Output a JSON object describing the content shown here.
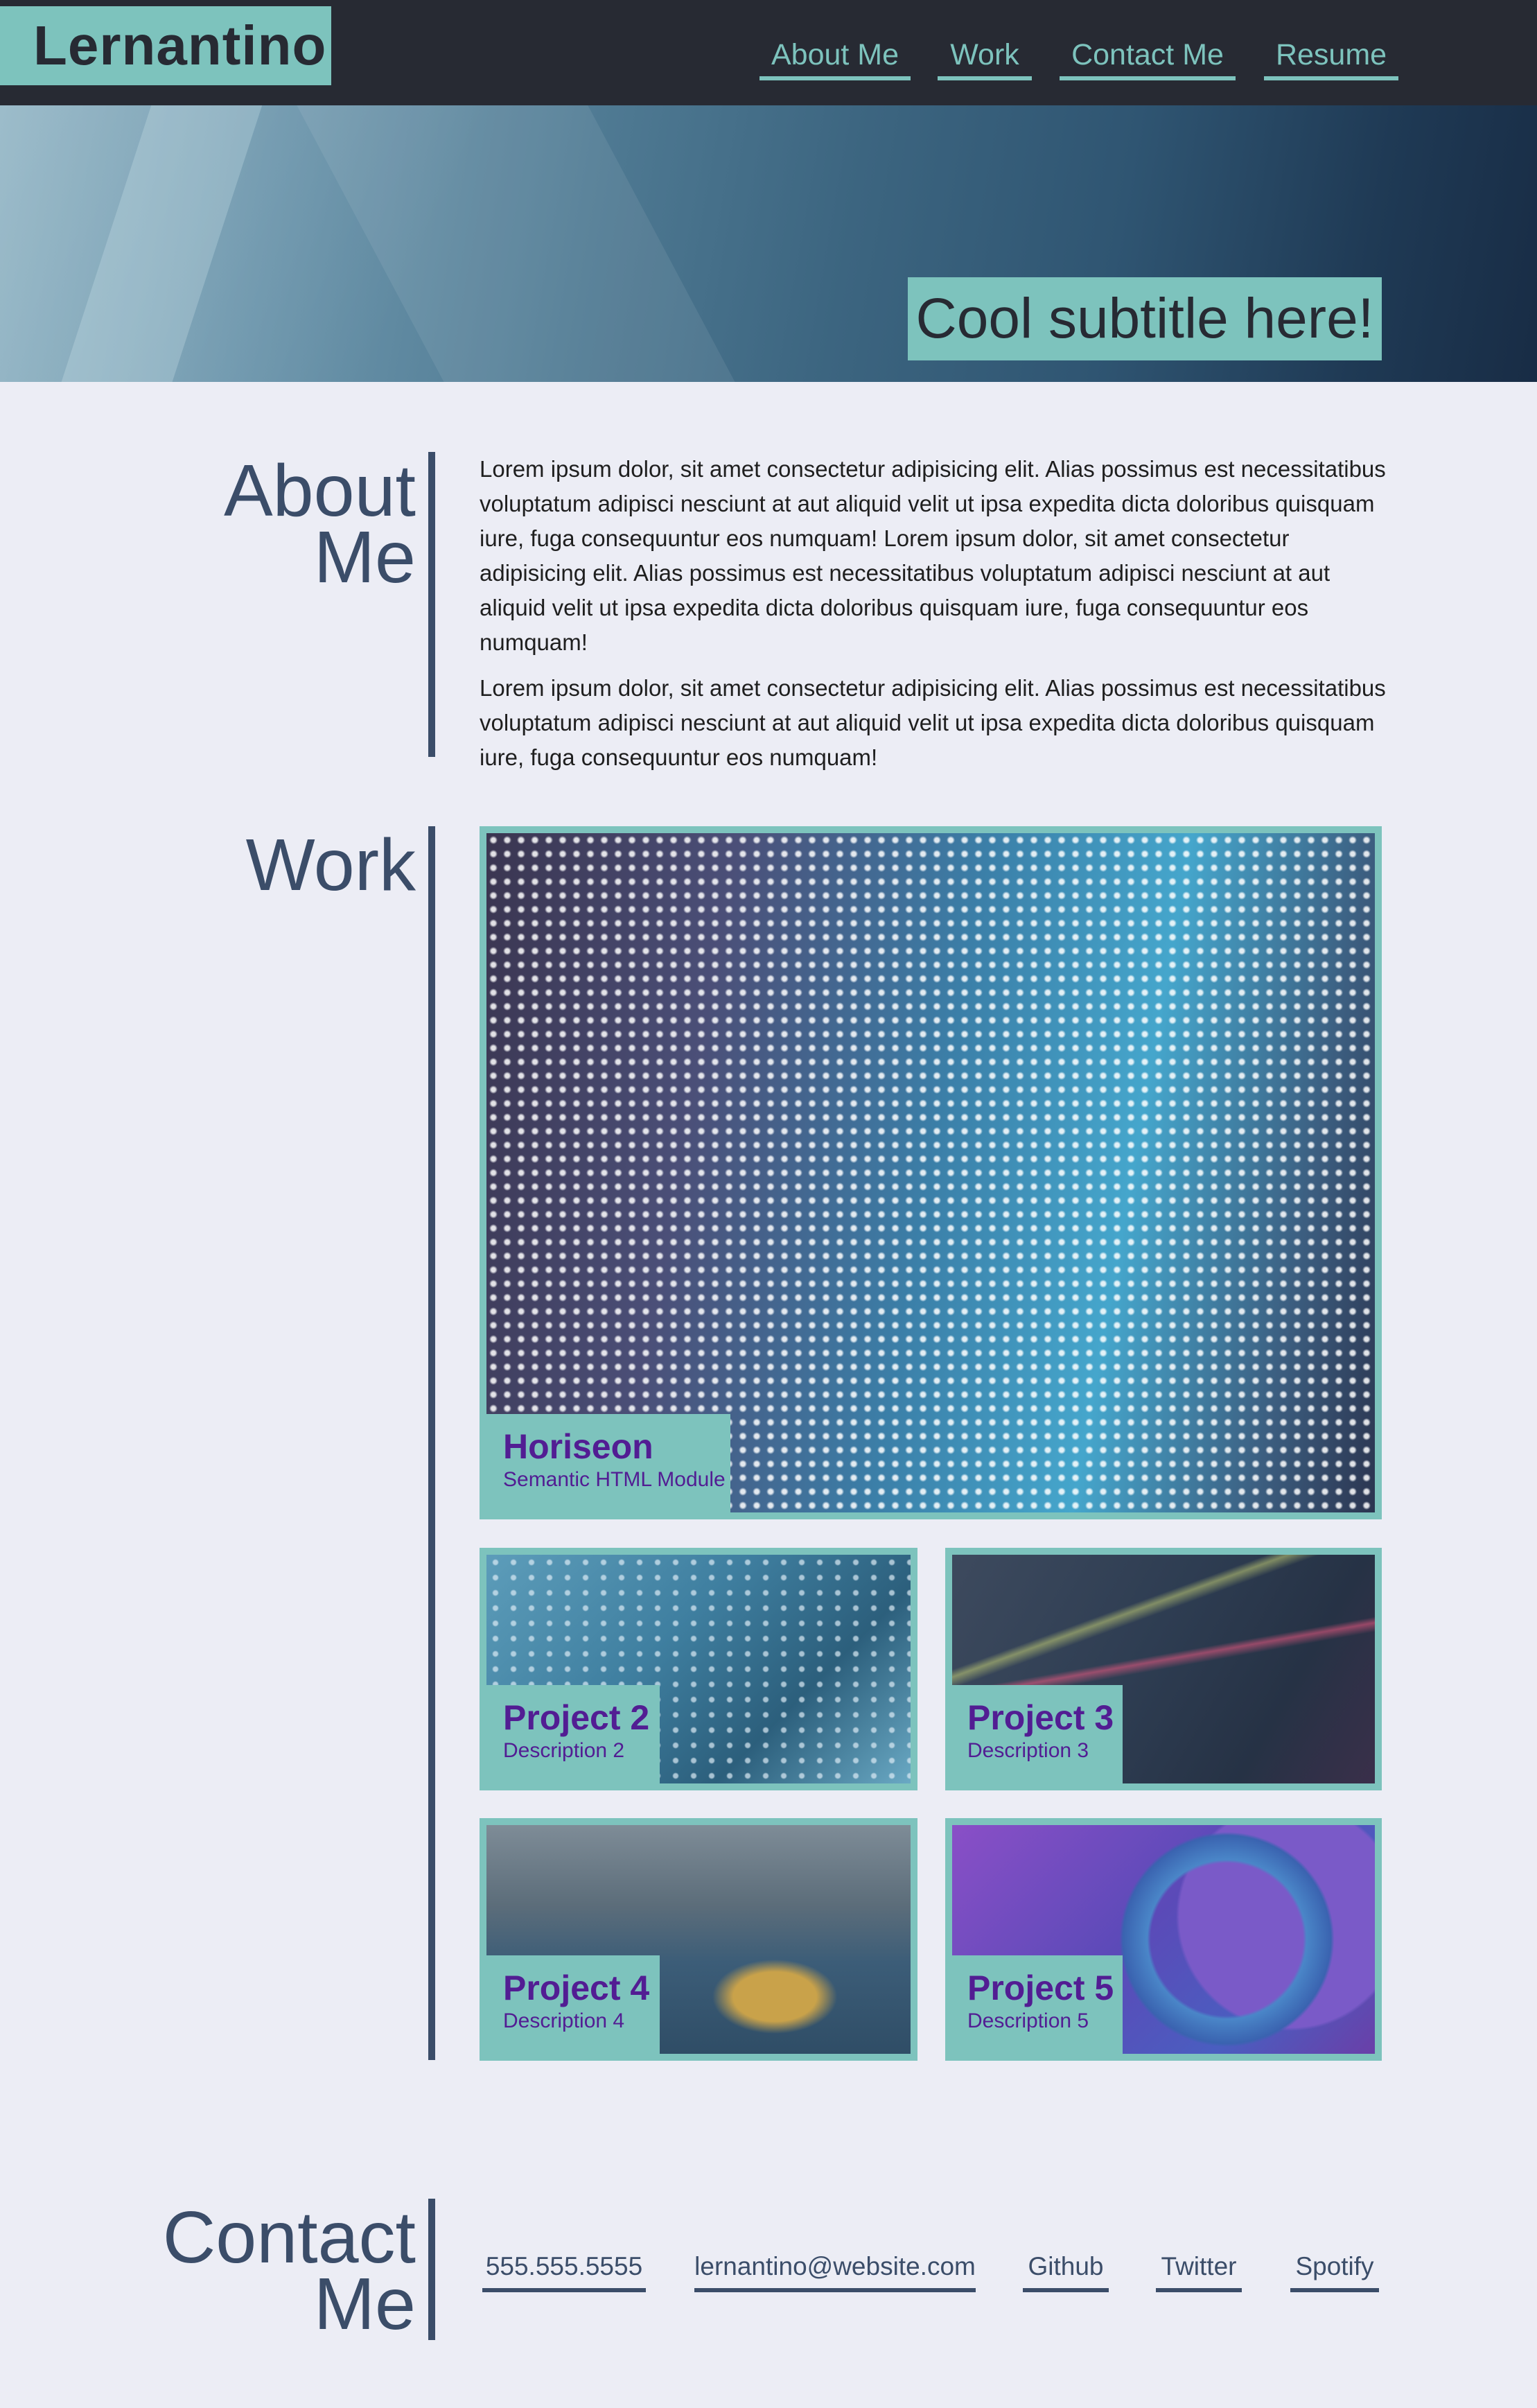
{
  "header": {
    "logo": "Lernantino",
    "nav": [
      "About Me",
      "Work",
      "Contact Me",
      "Resume"
    ]
  },
  "hero": {
    "subtitle": "Cool subtitle here!"
  },
  "about": {
    "title_line1": "About",
    "title_line2": "Me",
    "paragraphs": [
      "Lorem ipsum dolor, sit amet consectetur adipisicing elit. Alias possimus est necessitatibus voluptatum adipisci nesciunt at aut aliquid velit ut ipsa expedita dicta doloribus quisquam iure, fuga consequuntur eos numquam! Lorem ipsum dolor, sit amet consectetur adipisicing elit. Alias possimus est necessitatibus voluptatum adipisci nesciunt at aut aliquid velit ut ipsa expedita dicta doloribus quisquam iure, fuga consequuntur eos numquam!",
      "Lorem ipsum dolor, sit amet consectetur adipisicing elit. Alias possimus est necessitatibus voluptatum adipisci nesciunt at aut aliquid velit ut ipsa expedita dicta doloribus quisquam iure, fuga consequuntur eos numquam!"
    ]
  },
  "work": {
    "title": "Work",
    "projects": [
      {
        "title": "Horiseon",
        "description": "Semantic HTML Module"
      },
      {
        "title": "Project 2",
        "description": "Description 2"
      },
      {
        "title": "Project 3",
        "description": "Description 3"
      },
      {
        "title": "Project 4",
        "description": "Description 4"
      },
      {
        "title": "Project 5",
        "description": "Description 5"
      }
    ]
  },
  "contact": {
    "title_line1": "Contact",
    "title_line2": "Me",
    "links": [
      "555.555.5555",
      "lernantino@website.com",
      "Github",
      "Twitter",
      "Spotify"
    ]
  },
  "colors": {
    "accent": "#7dc3bd",
    "header_bg": "#272a33",
    "heading": "#3b4d69",
    "project_title": "#521d93",
    "page_bg": "#ecedf5"
  }
}
